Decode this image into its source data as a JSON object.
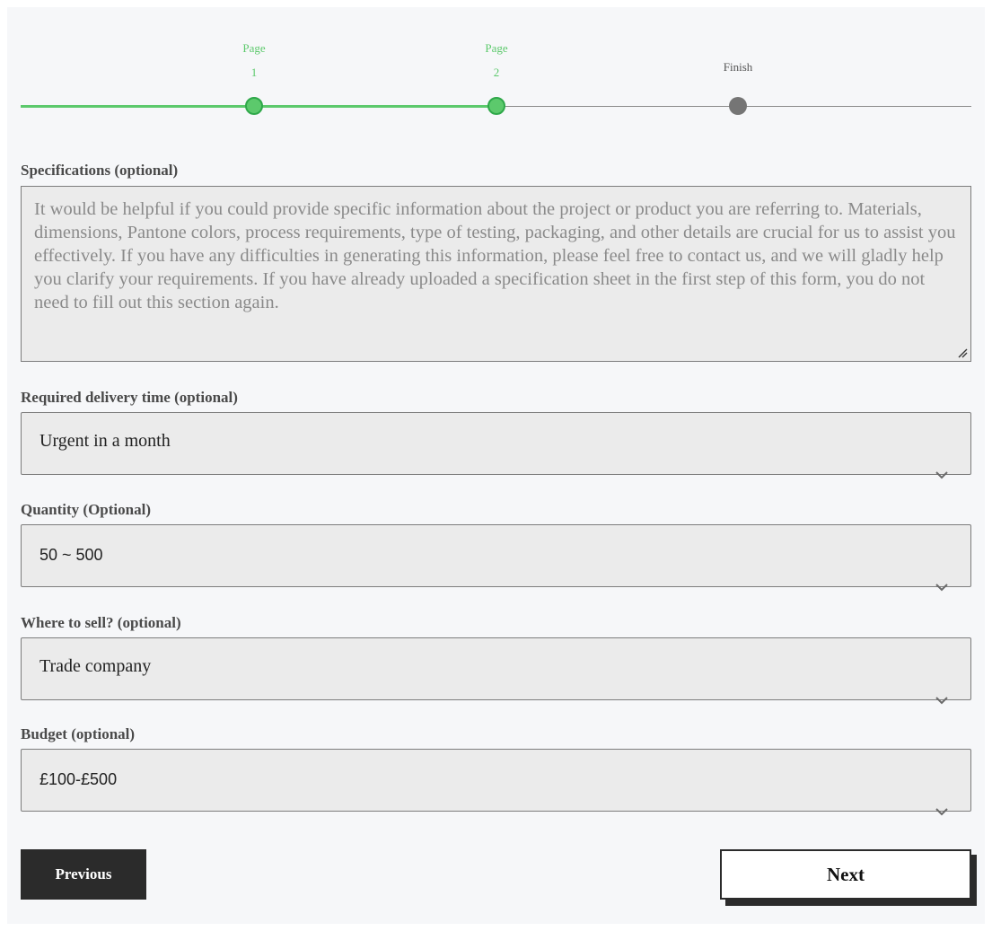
{
  "colors": {
    "accent_green": "#5cc96c",
    "step_done_text": "#5cc96c",
    "step_todo": "#757575",
    "field_bg": "#ebebeb"
  },
  "progress": {
    "steps": [
      {
        "line1": "Page",
        "line2": "1",
        "state": "done"
      },
      {
        "line1": "Page",
        "line2": "2",
        "state": "done"
      },
      {
        "line1": "Finish",
        "line2": "",
        "state": "todo"
      }
    ]
  },
  "form": {
    "specifications": {
      "label": "Specifications (optional)",
      "placeholder": "It would be helpful if you could provide specific information about the project or product you are referring to. Materials, dimensions, Pantone colors, process requirements, type of testing, packaging, and other details are crucial for us to assist you effectively. If you have any difficulties in generating this information, please feel free to contact us, and we will gladly help you clarify your requirements. If you have already uploaded a specification sheet in the first step of this form, you do not need to fill out this section again."
    },
    "delivery_time": {
      "label": "Required delivery time (optional)",
      "value": "Urgent in a month"
    },
    "quantity": {
      "label": "Quantity (Optional)",
      "value": "50 ~ 500"
    },
    "where_to_sell": {
      "label": "Where to sell? (optional)",
      "value": "Trade company"
    },
    "budget": {
      "label": "Budget (optional)",
      "value": "£100-£500"
    }
  },
  "buttons": {
    "previous": "Previous",
    "next": "Next"
  },
  "icons": {
    "select_indicator": "chevron-down-icon",
    "textarea_resize": "resize-handle-icon"
  }
}
